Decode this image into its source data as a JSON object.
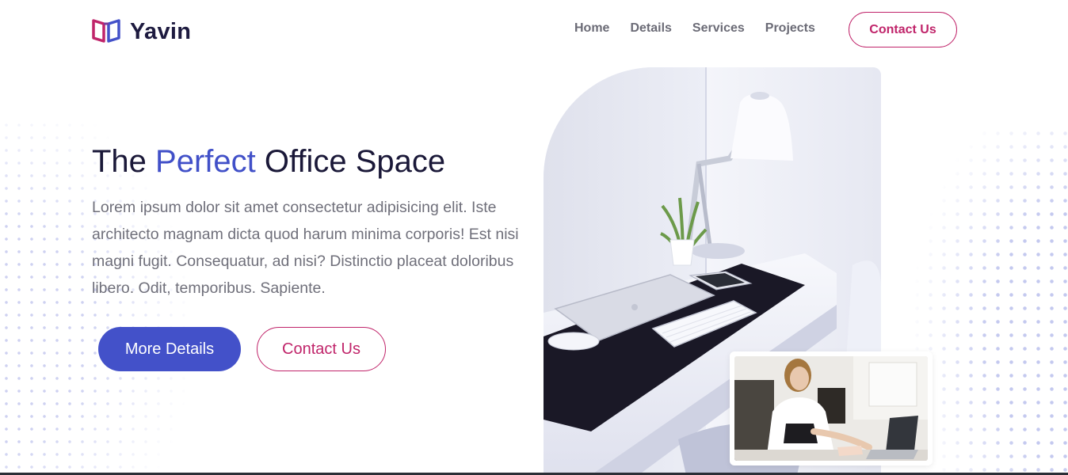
{
  "brand": {
    "name": "Yavin",
    "logo_icon": "book-icon"
  },
  "nav": {
    "links": [
      "Home",
      "Details",
      "Services",
      "Projects"
    ],
    "contact_label": "Contact Us"
  },
  "hero": {
    "title_part1": "The ",
    "title_accent": "Perfect",
    "title_part2": " Office Space",
    "description": "Lorem ipsum dolor sit amet consectetur adipisicing elit. Iste architecto magnam dicta quod harum minima corporis! Est nisi magni fugit. Consequatur, ad nisi? Distinctio placeat doloribus libero. Odit, temporibus. Sapiente.",
    "primary_button": "More Details",
    "secondary_button": "Contact Us"
  },
  "colors": {
    "accent_blue": "#4351c9",
    "accent_pink": "#c0246a",
    "heading": "#1a1838",
    "body_text": "#6f6f7a"
  }
}
